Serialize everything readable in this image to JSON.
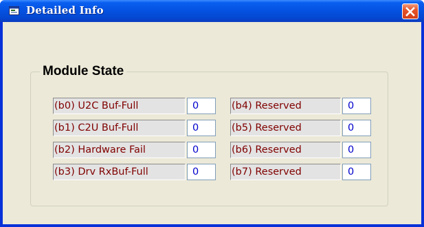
{
  "window": {
    "title": "Detailed Info",
    "title_icon": "app-window-icon",
    "close_icon": "close-x-icon"
  },
  "group": {
    "title": "Module State"
  },
  "states": [
    {
      "label": "(b0) U2C Buf-Full",
      "value": "0"
    },
    {
      "label": "(b1) C2U Buf-Full",
      "value": "0"
    },
    {
      "label": "(b2) Hardware Fail",
      "value": "0"
    },
    {
      "label": "(b3) Drv RxBuf-Full",
      "value": "0"
    },
    {
      "label": "(b4) Reserved",
      "value": "0"
    },
    {
      "label": "(b5) Reserved",
      "value": "0"
    },
    {
      "label": "(b6) Reserved",
      "value": "0"
    },
    {
      "label": "(b7) Reserved",
      "value": "0"
    }
  ],
  "colors": {
    "titlebar": "#0553e2",
    "client_bg": "#ece9d8",
    "label_text": "#800000",
    "value_text": "#0000cc",
    "close_button": "#d2401a"
  }
}
